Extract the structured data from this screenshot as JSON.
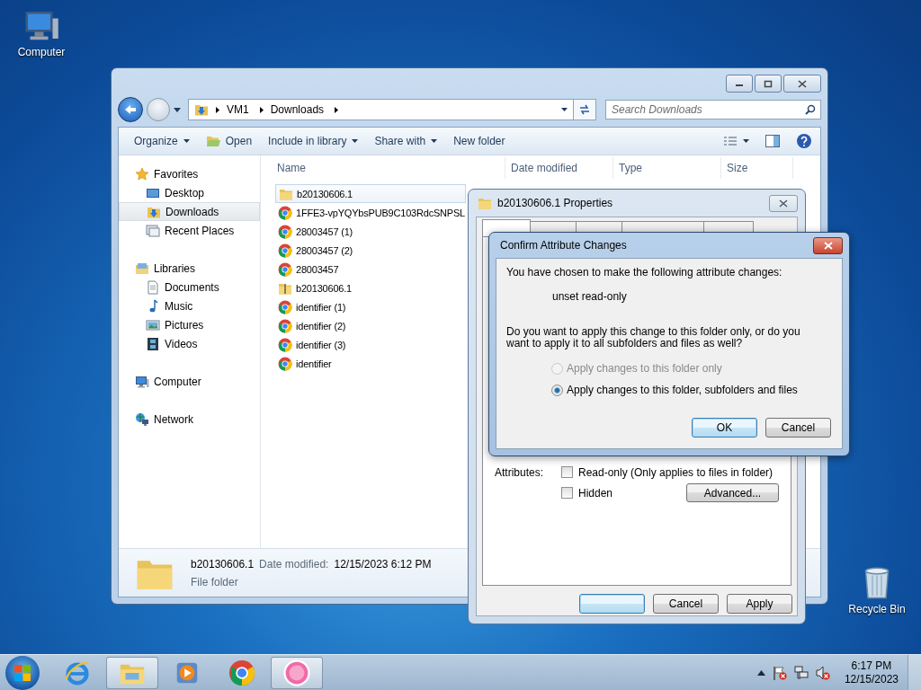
{
  "desktop_icons": [
    {
      "label": "Computer",
      "kind": "computer"
    },
    {
      "label": "Recycle Bin",
      "kind": "recycle"
    }
  ],
  "explorer": {
    "address": [
      "VM1",
      "Downloads"
    ],
    "search": {
      "placeholder": "Search Downloads"
    },
    "toolbar": [
      {
        "label": "Organize",
        "dropdown": true
      },
      {
        "label": "Open",
        "dropdown": false,
        "kind": "open"
      },
      {
        "label": "Include in library",
        "dropdown": true
      },
      {
        "label": "Share with",
        "dropdown": true
      },
      {
        "label": "New folder",
        "dropdown": false
      }
    ],
    "sidebar": [
      {
        "label": "Favorites",
        "kind": "star",
        "selected": false,
        "children": [
          {
            "label": "Desktop",
            "kind": "desktop",
            "selected": false
          },
          {
            "label": "Downloads",
            "kind": "downloads",
            "selected": true
          },
          {
            "label": "Recent Places",
            "kind": "recent",
            "selected": false
          }
        ]
      },
      {
        "label": "Libraries",
        "kind": "library",
        "selected": false,
        "children": [
          {
            "label": "Documents",
            "kind": "document",
            "selected": false
          },
          {
            "label": "Music",
            "kind": "music",
            "selected": false
          },
          {
            "label": "Pictures",
            "kind": "pictures",
            "selected": false
          },
          {
            "label": "Videos",
            "kind": "videos",
            "selected": false
          }
        ]
      },
      {
        "label": "Computer",
        "kind": "computer",
        "selected": false
      },
      {
        "label": "Network",
        "kind": "network",
        "selected": false
      }
    ],
    "columns": [
      "Name",
      "Date modified",
      "Type",
      "Size"
    ],
    "files": [
      {
        "name": "b20130606.1",
        "kind": "folder",
        "selected": true
      },
      {
        "name": "1FFE3-vpYQYbsPUB9C103RdcSNPSL",
        "kind": "chrome",
        "selected": false
      },
      {
        "name": "28003457 (1)",
        "kind": "chrome",
        "selected": false
      },
      {
        "name": "28003457 (2)",
        "kind": "chrome",
        "selected": false
      },
      {
        "name": "28003457",
        "kind": "chrome",
        "selected": false
      },
      {
        "name": "b20130606.1",
        "kind": "zip",
        "selected": false
      },
      {
        "name": "identifier (1)",
        "kind": "chrome",
        "selected": false
      },
      {
        "name": "identifier (2)",
        "kind": "chrome",
        "selected": false
      },
      {
        "name": "identifier (3)",
        "kind": "chrome",
        "selected": false
      },
      {
        "name": "identifier",
        "kind": "chrome",
        "selected": false
      }
    ],
    "details": {
      "name": "b20130606.1",
      "date_label": "Date modified:",
      "date": "12/15/2023 6:12 PM",
      "type": "File folder"
    }
  },
  "properties": {
    "title": "b20130606.1 Properties",
    "tabs": [
      {
        "selected": true
      },
      {
        "selected": false
      },
      {
        "selected": false
      },
      {
        "selected": false
      },
      {
        "selected": false
      }
    ],
    "attributes_label": "Attributes:",
    "attributes": [
      {
        "label": "Read-only (Only applies to files in folder)",
        "checked": false
      },
      {
        "label": "Hidden",
        "checked": false
      }
    ],
    "advanced": "Advanced...",
    "buttons": [
      {
        "kind": "default"
      },
      {
        "kind": "normal",
        "label": "Cancel"
      },
      {
        "kind": "normal",
        "label": "Apply"
      }
    ]
  },
  "confirm": {
    "title": "Confirm Attribute Changes",
    "message": "You have chosen to make the following attribute changes:",
    "change": "unset read-only",
    "question": "Do you want to apply this change to this folder only, or do you want to apply it to all subfolders and files as well?",
    "options": [
      {
        "label": "Apply changes to this folder only",
        "selected": false,
        "disabled": true
      },
      {
        "label": "Apply changes to this folder, subfolders and files",
        "selected": true,
        "disabled": false
      }
    ],
    "buttons": [
      {
        "kind": "default",
        "label": "OK"
      },
      {
        "kind": "normal",
        "label": "Cancel"
      }
    ]
  },
  "taskbar": {
    "apps": [
      {
        "kind": "ie",
        "active": false
      },
      {
        "kind": "explorer",
        "active": true
      },
      {
        "kind": "media",
        "active": false
      },
      {
        "kind": "chrome",
        "active": false
      },
      {
        "kind": "osu",
        "active": true
      }
    ],
    "time": "6:17 PM",
    "date": "12/15/2023"
  }
}
